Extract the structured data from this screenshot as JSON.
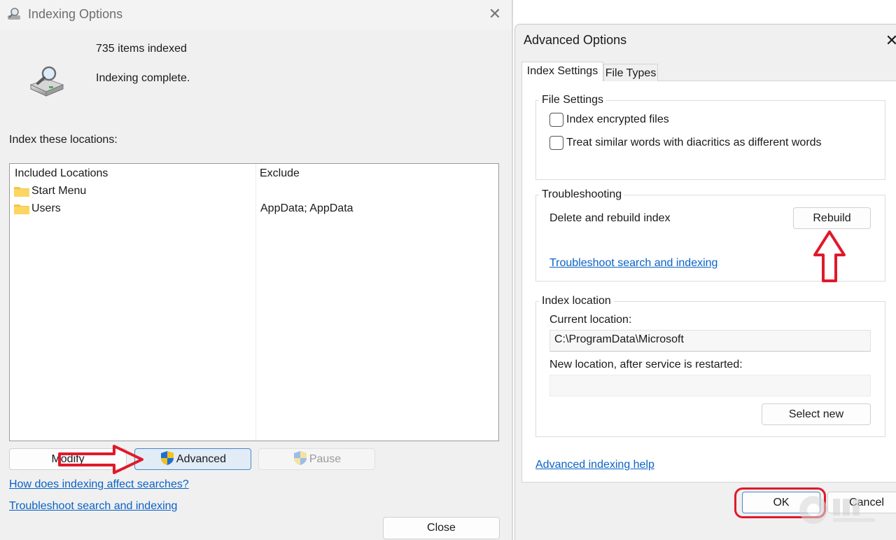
{
  "left_window": {
    "title": "Indexing Options",
    "close_glyph": "✕",
    "items_indexed": "735 items indexed",
    "status": "Indexing complete.",
    "locations_heading": "Index these locations:",
    "table": {
      "headers": {
        "included": "Included Locations",
        "exclude": "Exclude"
      },
      "rows": [
        {
          "name": "Start Menu",
          "exclude": ""
        },
        {
          "name": "Users",
          "exclude": "AppData; AppData"
        }
      ]
    },
    "buttons": {
      "modify": "Modify",
      "advanced": "Advanced",
      "pause": "Pause",
      "close": "Close"
    },
    "links": {
      "affect": "How does indexing affect searches?",
      "troubleshoot": "Troubleshoot search and indexing"
    },
    "icons": {
      "window": "indexing-magnifier-drive-icon",
      "folder": "folder-icon",
      "shield": "uac-shield-icon"
    }
  },
  "right_window": {
    "title": "Advanced Options",
    "close_glyph": "✕",
    "tabs": [
      {
        "label": "Index Settings",
        "active": true
      },
      {
        "label": "File Types",
        "active": false
      }
    ],
    "file_settings": {
      "title": "File Settings",
      "options": [
        {
          "label": "Index encrypted files",
          "checked": false
        },
        {
          "label": "Treat similar words with diacritics as different words",
          "checked": false
        }
      ]
    },
    "troubleshooting": {
      "title": "Troubleshooting",
      "rebuild_label": "Delete and rebuild index",
      "rebuild_button": "Rebuild",
      "link": "Troubleshoot search and indexing"
    },
    "index_location": {
      "title": "Index location",
      "current_label": "Current location:",
      "current_value": "C:\\ProgramData\\Microsoft",
      "new_label": "New location, after service is restarted:",
      "new_value": "",
      "select_button": "Select new"
    },
    "help_link": "Advanced indexing help",
    "ok_button": "OK",
    "cancel_button": "Cancel"
  },
  "colors": {
    "link": "#0a62c6",
    "annotation_red": "#e0192b",
    "advanced_button_bg": "#e1ecf6"
  }
}
